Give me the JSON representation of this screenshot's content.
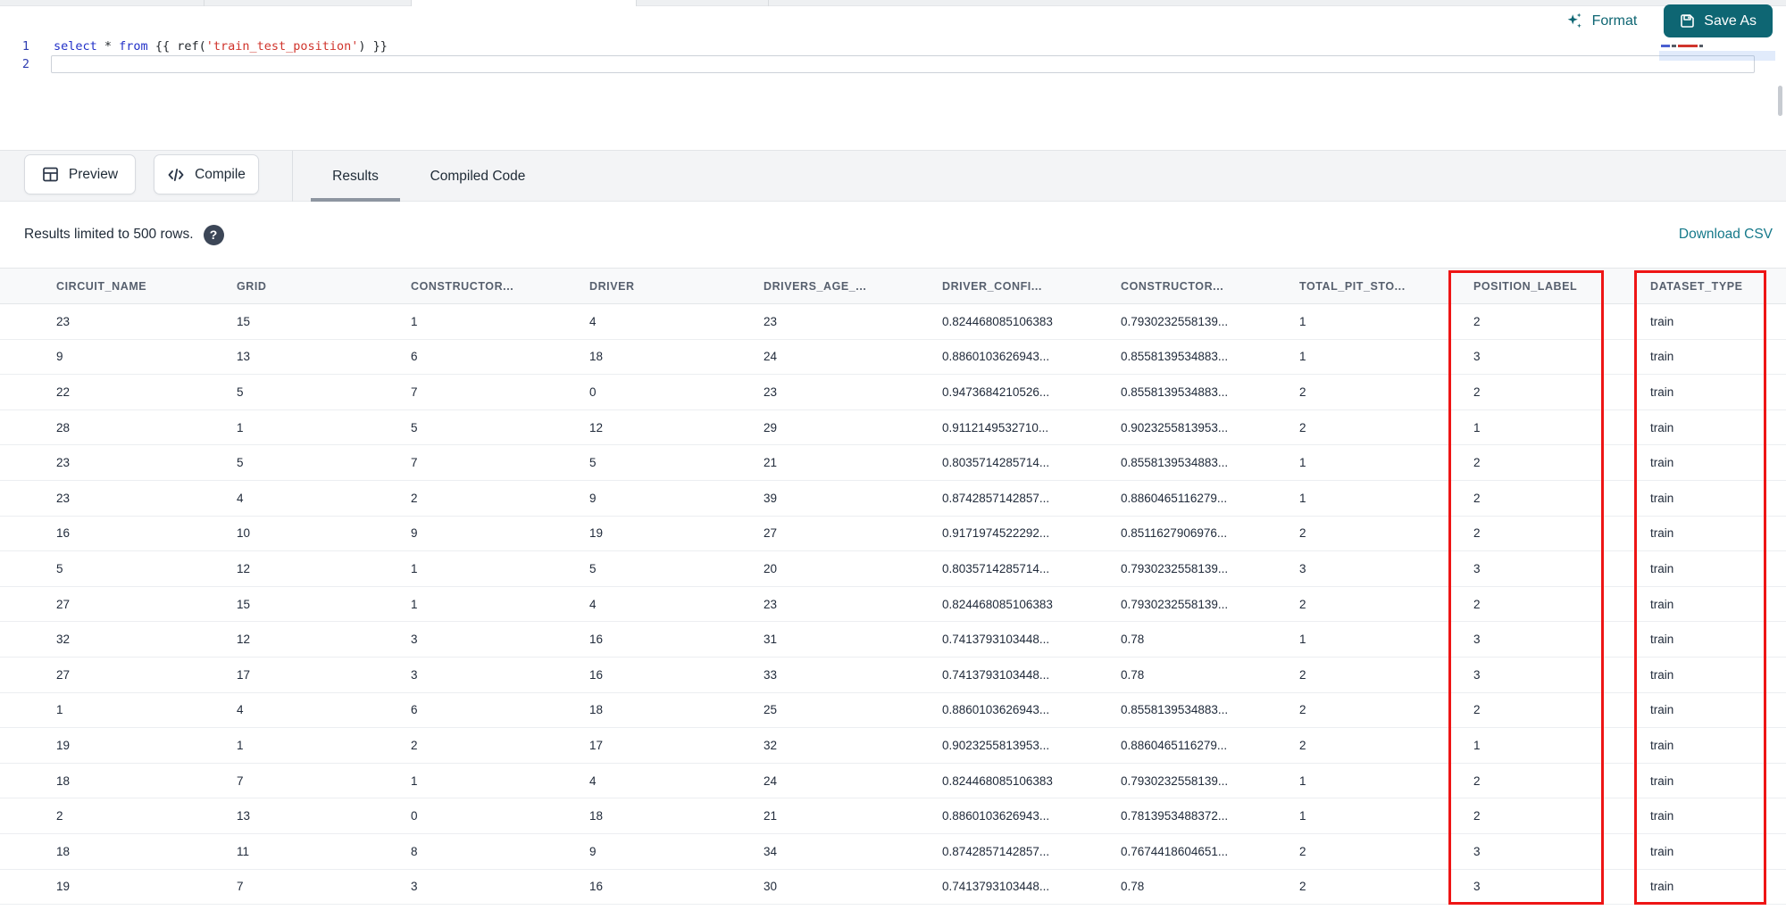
{
  "colors": {
    "accent_teal": "#0e6673",
    "link_teal": "#15798a",
    "highlight_red": "#ee1515",
    "keyword_blue": "#2231c8",
    "string_red": "#d0342c"
  },
  "editor": {
    "toolbar": {
      "format_label": "Format",
      "save_as_label": "Save As"
    },
    "lines": [
      {
        "number": "1",
        "active": false,
        "tokens": [
          {
            "text": "select",
            "type": "keyword"
          },
          {
            "text": " * ",
            "type": "plain"
          },
          {
            "text": "from",
            "type": "keyword"
          },
          {
            "text": " {{ ref(",
            "type": "plain"
          },
          {
            "text": "'train_test_position'",
            "type": "string"
          },
          {
            "text": ") }}",
            "type": "plain"
          }
        ]
      },
      {
        "number": "2",
        "active": true,
        "tokens": []
      }
    ]
  },
  "action_bar": {
    "preview_label": "Preview",
    "compile_label": "Compile",
    "tabs": [
      {
        "label": "Results",
        "active": true
      },
      {
        "label": "Compiled Code",
        "active": false
      }
    ]
  },
  "results_bar": {
    "limit_text": "Results limited to 500 rows.",
    "help_icon": "?",
    "download_label": "Download CSV"
  },
  "table": {
    "columns": [
      "CIRCUIT_NAME",
      "GRID",
      "CONSTRUCTOR...",
      "DRIVER",
      "DRIVERS_AGE_...",
      "DRIVER_CONFI...",
      "CONSTRUCTOR...",
      "TOTAL_PIT_STO...",
      "POSITION_LABEL",
      "DATASET_TYPE"
    ],
    "highlighted_columns": [
      "POSITION_LABEL",
      "DATASET_TYPE"
    ],
    "rows": [
      [
        "23",
        "15",
        "1",
        "4",
        "23",
        "0.824468085106383",
        "0.7930232558139...",
        "1",
        "2",
        "train"
      ],
      [
        "9",
        "13",
        "6",
        "18",
        "24",
        "0.8860103626943...",
        "0.8558139534883...",
        "1",
        "3",
        "train"
      ],
      [
        "22",
        "5",
        "7",
        "0",
        "23",
        "0.9473684210526...",
        "0.8558139534883...",
        "2",
        "2",
        "train"
      ],
      [
        "28",
        "1",
        "5",
        "12",
        "29",
        "0.9112149532710...",
        "0.9023255813953...",
        "2",
        "1",
        "train"
      ],
      [
        "23",
        "5",
        "7",
        "5",
        "21",
        "0.8035714285714...",
        "0.8558139534883...",
        "1",
        "2",
        "train"
      ],
      [
        "23",
        "4",
        "2",
        "9",
        "39",
        "0.8742857142857...",
        "0.8860465116279...",
        "1",
        "2",
        "train"
      ],
      [
        "16",
        "10",
        "9",
        "19",
        "27",
        "0.9171974522292...",
        "0.8511627906976...",
        "2",
        "2",
        "train"
      ],
      [
        "5",
        "12",
        "1",
        "5",
        "20",
        "0.8035714285714...",
        "0.7930232558139...",
        "3",
        "3",
        "train"
      ],
      [
        "27",
        "15",
        "1",
        "4",
        "23",
        "0.824468085106383",
        "0.7930232558139...",
        "2",
        "2",
        "train"
      ],
      [
        "32",
        "12",
        "3",
        "16",
        "31",
        "0.7413793103448...",
        "0.78",
        "1",
        "3",
        "train"
      ],
      [
        "27",
        "17",
        "3",
        "16",
        "33",
        "0.7413793103448...",
        "0.78",
        "2",
        "3",
        "train"
      ],
      [
        "1",
        "4",
        "6",
        "18",
        "25",
        "0.8860103626943...",
        "0.8558139534883...",
        "2",
        "2",
        "train"
      ],
      [
        "19",
        "1",
        "2",
        "17",
        "32",
        "0.9023255813953...",
        "0.8860465116279...",
        "2",
        "1",
        "train"
      ],
      [
        "18",
        "7",
        "1",
        "4",
        "24",
        "0.824468085106383",
        "0.7930232558139...",
        "1",
        "2",
        "train"
      ],
      [
        "2",
        "13",
        "0",
        "18",
        "21",
        "0.8860103626943...",
        "0.7813953488372...",
        "1",
        "2",
        "train"
      ],
      [
        "18",
        "11",
        "8",
        "9",
        "34",
        "0.8742857142857...",
        "0.7674418604651...",
        "2",
        "3",
        "train"
      ],
      [
        "19",
        "7",
        "3",
        "16",
        "30",
        "0.7413793103448...",
        "0.78",
        "2",
        "3",
        "train"
      ]
    ]
  }
}
